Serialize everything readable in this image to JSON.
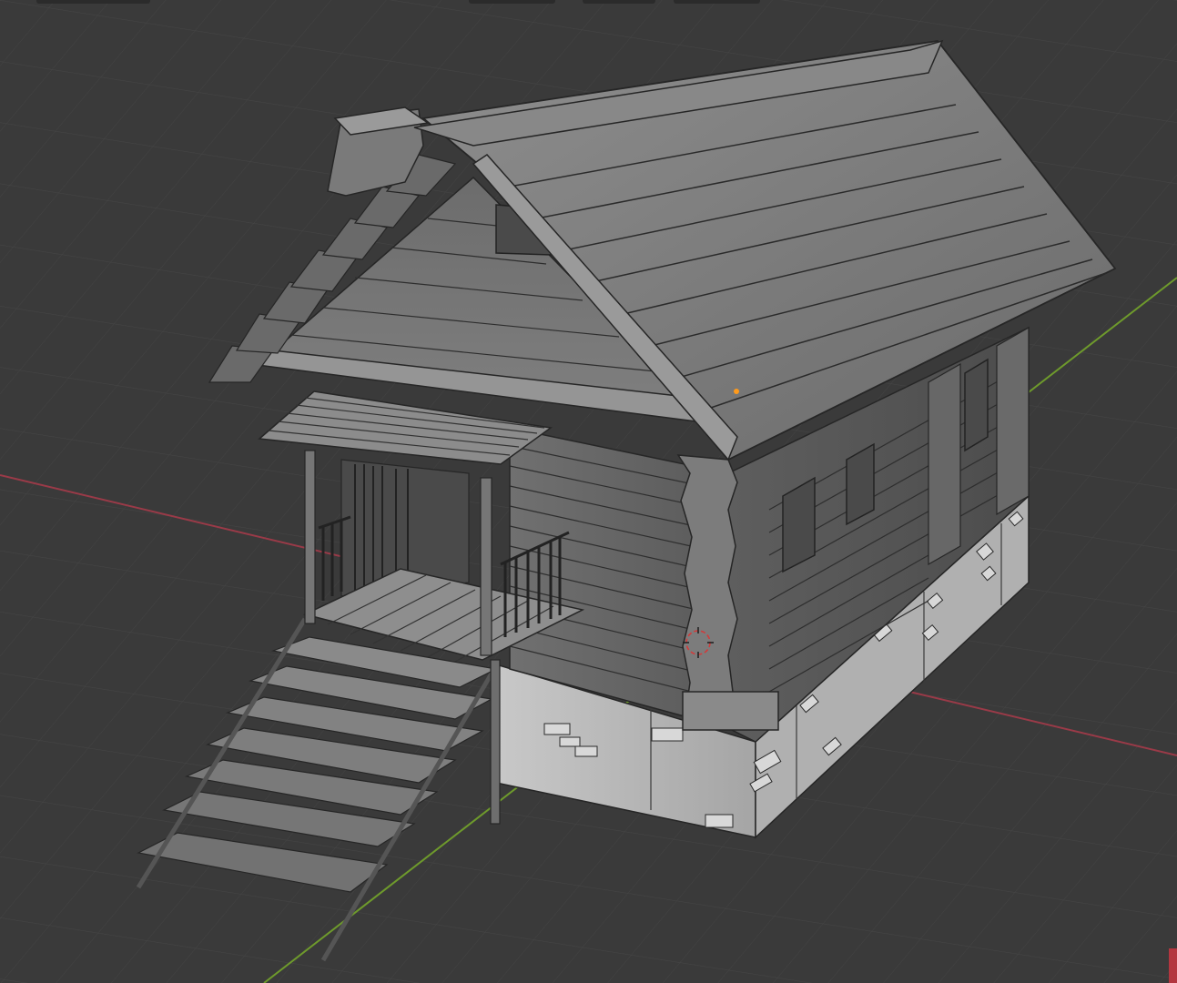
{
  "viewport": {
    "background": "#3a3a3a",
    "grid_color": "#454545",
    "x_axis_color": "#9a3a48",
    "y_axis_color": "#6e9a2c",
    "mesh_light": "#a8a8a8",
    "mesh_mid": "#7b7b7b",
    "mesh_dark": "#525252",
    "edge_color": "#262626",
    "foundation_color": "#bdbdbd",
    "origin_dot_color": "#ff9a1a",
    "cursor_color": "#d23a3a"
  },
  "header": {
    "tool_slots": [
      "left-header-tab",
      "view-tab-1",
      "view-tab-2",
      "view-tab-3"
    ]
  },
  "scene": {
    "object": "log-cabin",
    "parts": [
      "roof",
      "gable-end",
      "chimney",
      "porch-canopy",
      "porch-deck",
      "stairs",
      "railing",
      "log-walls",
      "stone-foundation",
      "windows"
    ]
  },
  "icons": {
    "origin": "object-origin-icon",
    "cursor": "3d-cursor-icon"
  }
}
